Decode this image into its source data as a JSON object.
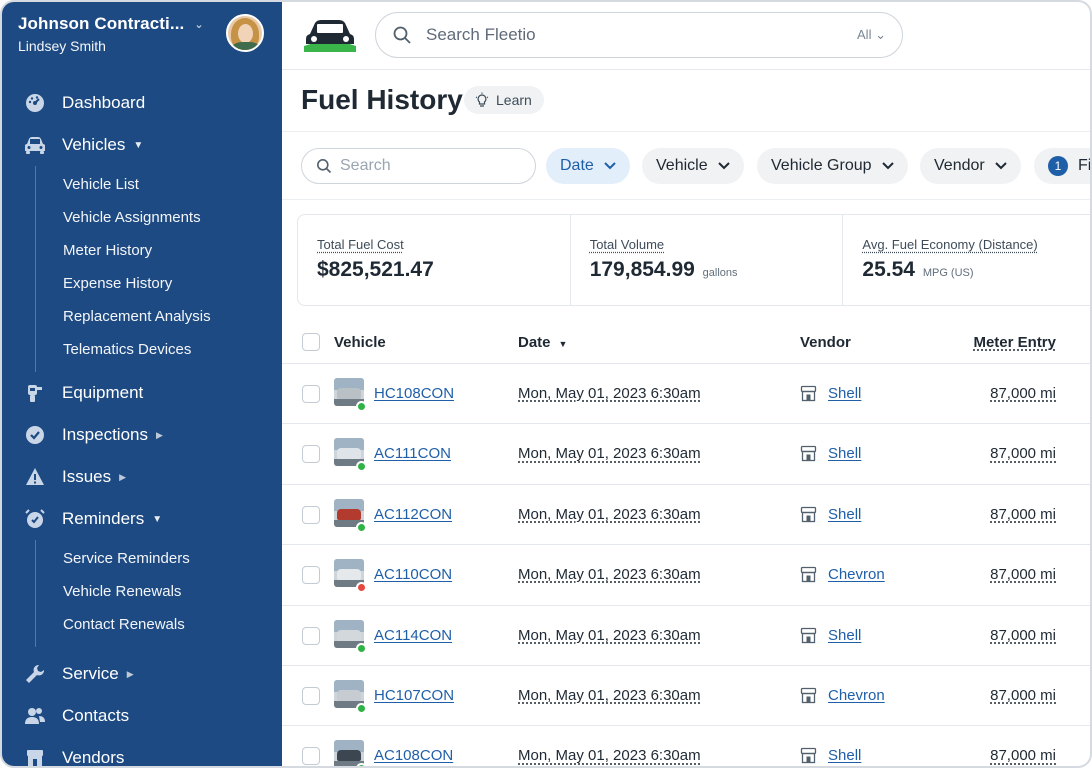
{
  "account": {
    "company": "Johnson Contracti...",
    "user": "Lindsey Smith"
  },
  "sidebar": {
    "items": [
      {
        "label": "Dashboard",
        "icon": "dashboard-icon"
      },
      {
        "label": "Vehicles",
        "icon": "car-icon",
        "expanded": true,
        "children": [
          "Vehicle List",
          "Vehicle Assignments",
          "Meter History",
          "Expense History",
          "Replacement Analysis",
          "Telematics Devices"
        ]
      },
      {
        "label": "Equipment",
        "icon": "equipment-icon"
      },
      {
        "label": "Inspections",
        "icon": "check-circle-icon"
      },
      {
        "label": "Issues",
        "icon": "warning-icon"
      },
      {
        "label": "Reminders",
        "icon": "alarm-icon",
        "expanded": true,
        "children": [
          "Service Reminders",
          "Vehicle Renewals",
          "Contact Renewals"
        ]
      },
      {
        "label": "Service",
        "icon": "wrench-icon"
      },
      {
        "label": "Contacts",
        "icon": "people-icon"
      },
      {
        "label": "Vendors",
        "icon": "store-icon"
      }
    ]
  },
  "topbar": {
    "search_placeholder": "Search Fleetio",
    "search_scope": "All"
  },
  "page": {
    "title": "Fuel History",
    "learn_label": "Learn"
  },
  "filters": {
    "search_placeholder": "Search",
    "chips": [
      {
        "label": "Date",
        "active": true
      },
      {
        "label": "Vehicle",
        "active": false
      },
      {
        "label": "Vehicle Group",
        "active": false
      },
      {
        "label": "Vendor",
        "active": false
      }
    ],
    "more_count": "1",
    "more_label": "Filters"
  },
  "stats": [
    {
      "label": "Total Fuel Cost",
      "value": "$825,521.47",
      "unit": ""
    },
    {
      "label": "Total Volume",
      "value": "179,854.99",
      "unit": "gallons"
    },
    {
      "label": "Avg. Fuel Economy (Distance)",
      "value": "25.54",
      "unit": "MPG (US)"
    }
  ],
  "table": {
    "columns": {
      "vehicle": "Vehicle",
      "date": "Date",
      "vendor": "Vendor",
      "meter": "Meter Entry"
    },
    "rows": [
      {
        "vehicle": "HC108CON",
        "status": "green",
        "car_color": "#b9c0c6",
        "date": "Mon, May 01, 2023 6:30am",
        "vendor": "Shell",
        "meter": "87,000 mi"
      },
      {
        "vehicle": "AC111CON",
        "status": "green",
        "car_color": "#dfe4e8",
        "date": "Mon, May 01, 2023 6:30am",
        "vendor": "Shell",
        "meter": "87,000 mi"
      },
      {
        "vehicle": "AC112CON",
        "status": "green",
        "car_color": "#b23a2e",
        "date": "Mon, May 01, 2023 6:30am",
        "vendor": "Shell",
        "meter": "87,000 mi"
      },
      {
        "vehicle": "AC110CON",
        "status": "red",
        "car_color": "#e6e9ec",
        "date": "Mon, May 01, 2023 6:30am",
        "vendor": "Chevron",
        "meter": "87,000 mi"
      },
      {
        "vehicle": "AC114CON",
        "status": "green",
        "car_color": "#d3d8dc",
        "date": "Mon, May 01, 2023 6:30am",
        "vendor": "Shell",
        "meter": "87,000 mi"
      },
      {
        "vehicle": "HC107CON",
        "status": "green",
        "car_color": "#c6ccd2",
        "date": "Mon, May 01, 2023 6:30am",
        "vendor": "Chevron",
        "meter": "87,000 mi"
      },
      {
        "vehicle": "AC108CON",
        "status": "green",
        "car_color": "#3b4650",
        "date": "Mon, May 01, 2023 6:30am",
        "vendor": "Shell",
        "meter": "87,000 mi"
      }
    ]
  },
  "colors": {
    "sidebar_bg": "#1d4a82",
    "accent": "#1f5fa8",
    "status_green": "#2fb344",
    "status_red": "#e5483e",
    "logo_green": "#3ab54a"
  }
}
